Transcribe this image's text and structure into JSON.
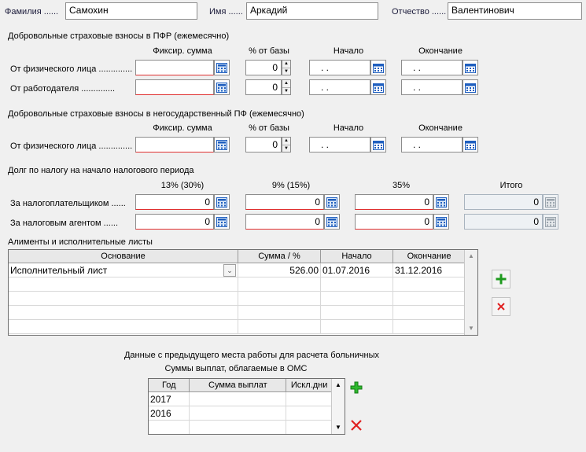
{
  "person": {
    "lastname_label": "Фамилия ......",
    "lastname_value": "Самохин",
    "firstname_label": "Имя ......",
    "firstname_value": "Аркадий",
    "patronymic_label": "Отчество ......",
    "patronymic_value": "Валентинович"
  },
  "pfr": {
    "section_title": "Добровольные страховые взносы в ПФР (ежемесячно)",
    "col_fixed": "Фиксир. сумма",
    "col_percent": "% от базы",
    "col_start": "Начало",
    "col_end": "Окончание",
    "rows": [
      {
        "label": "От физического лица ..............",
        "fixed": "",
        "percent": "0",
        "start": " .  .",
        "end": " .  ."
      },
      {
        "label": "От работодателя ..............",
        "fixed": "",
        "percent": "0",
        "start": " .  .",
        "end": " .  ."
      }
    ]
  },
  "npf": {
    "section_title": "Добровольные страховые взносы в негосударственный ПФ (ежемесячно)",
    "col_fixed": "Фиксир. сумма",
    "col_percent": "% от базы",
    "col_start": "Начало",
    "col_end": "Окончание",
    "rows": [
      {
        "label": "От физического лица ..............",
        "fixed": "",
        "percent": "0",
        "start": " .  .",
        "end": " .  ."
      }
    ]
  },
  "debt": {
    "section_title": "Долг по налогу на начало налогового периода",
    "col_13": "13% (30%)",
    "col_9": "9% (15%)",
    "col_35": "35%",
    "col_total": "Итого",
    "rows": [
      {
        "label": "За налогоплательщиком ......",
        "v13": "0",
        "v9": "0",
        "v35": "0",
        "total": "0"
      },
      {
        "label": "За налоговым агентом ......",
        "v13": "0",
        "v9": "0",
        "v35": "0",
        "total": "0"
      }
    ]
  },
  "alimony": {
    "section_title": "Алименты и исполнительные листы",
    "headers": [
      "Основание",
      "Сумма / %",
      "Начало",
      "Окончание"
    ],
    "rows": [
      {
        "basis": "Исполнительный лист",
        "amount": "526.00",
        "start": "01.07.2016",
        "end": "31.12.2016"
      }
    ]
  },
  "previous_job": {
    "title": "Данные с предыдущего места работы для расчета больничных",
    "subtitle": "Суммы выплат, облагаемые в ОМС",
    "headers": [
      "Год",
      "Сумма выплат",
      "Искл.дни"
    ],
    "rows": [
      {
        "year": "2017",
        "sum": "",
        "excl": ""
      },
      {
        "year": "2016",
        "sum": "",
        "excl": ""
      }
    ]
  },
  "colors": {
    "background": "#f0f0f0",
    "required_underline": "#e03030",
    "add_icon": "#1e9a1e",
    "delete_icon": "#e02020",
    "calendar_icon": "#1f5fbf"
  }
}
